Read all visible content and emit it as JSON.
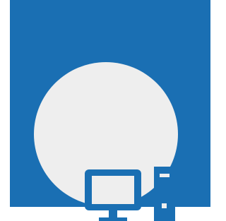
{
  "tile": {
    "background_color": "#1a6fb3"
  },
  "icon": {
    "name": "desktop-computer-icon",
    "color": "#1a6fb3",
    "circle_color": "#eeeeee"
  }
}
